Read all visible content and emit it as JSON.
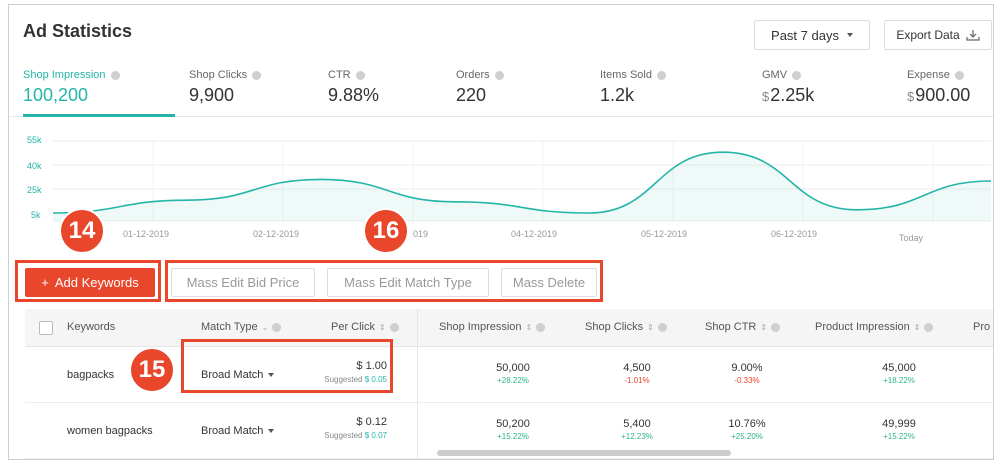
{
  "header": {
    "title": "Ad Statistics",
    "period_label": "Past 7 days",
    "export_label": "Export Data"
  },
  "metrics": [
    {
      "label": "Shop Impression",
      "value": "100,200",
      "currency": ""
    },
    {
      "label": "Shop Clicks",
      "value": "9,900",
      "currency": ""
    },
    {
      "label": "CTR",
      "value": "9.88%",
      "currency": ""
    },
    {
      "label": "Orders",
      "value": "220",
      "currency": ""
    },
    {
      "label": "Items Sold",
      "value": "1.2k",
      "currency": ""
    },
    {
      "label": "GMV",
      "value": "2.25k",
      "currency": "$"
    },
    {
      "label": "Expense",
      "value": "900.00",
      "currency": "$"
    }
  ],
  "chart_data": {
    "type": "line",
    "x": [
      "01-12-2019",
      "02-12-2019",
      "03-12-2019",
      "04-12-2019",
      "05-12-2019",
      "06-12-2019",
      "Today"
    ],
    "x_tick_labels": [
      "01-12-2019",
      "02-12-2019",
      "019",
      "04-12-2019",
      "05-12-2019",
      "06-12-2019",
      "Today"
    ],
    "y_tick_labels": [
      "55k",
      "40k",
      "25k",
      "5k"
    ],
    "series": [
      {
        "values": [
          10000,
          18000,
          31000,
          17000,
          10000,
          48000,
          12000,
          30000
        ]
      }
    ],
    "ylim": [
      5000,
      55000
    ],
    "grid": true,
    "color": "#24b5a8"
  },
  "callouts": {
    "b14": "14",
    "b15": "15",
    "b16": "16"
  },
  "toolbar": {
    "add_label": "Add Keywords",
    "mass_bid": "Mass Edit Bid Price",
    "mass_match": "Mass Edit Match Type",
    "mass_delete": "Mass Delete"
  },
  "table": {
    "headers": {
      "keywords": "Keywords",
      "match_type": "Match Type",
      "per_click": "Per Click",
      "shop_impression": "Shop Impression",
      "shop_clicks": "Shop Clicks",
      "shop_ctr": "Shop CTR",
      "product_impression": "Product Impression",
      "pro": "Pro"
    },
    "rows": [
      {
        "keyword": "bagpacks",
        "match": "Broad Match",
        "price": "$ 1.00",
        "suggested_label": "Suggested",
        "suggested": "$ 0.05",
        "impression": "50,000",
        "impression_delta": "+28.22%",
        "clicks": "4,500",
        "clicks_delta": "-1.01%",
        "ctr": "9.00%",
        "ctr_delta": "-0.33%",
        "prod_impression": "45,000",
        "prod_delta": "+18.22%"
      },
      {
        "keyword": "women bagpacks",
        "match": "Broad Match",
        "price": "$ 0.12",
        "suggested_label": "Suggested",
        "suggested": "$ 0.07",
        "impression": "50,200",
        "impression_delta": "+15.22%",
        "clicks": "5,400",
        "clicks_delta": "+12.23%",
        "ctr": "10.76%",
        "ctr_delta": "+25.20%",
        "prod_impression": "49,999",
        "prod_delta": "+15.22%"
      }
    ]
  }
}
